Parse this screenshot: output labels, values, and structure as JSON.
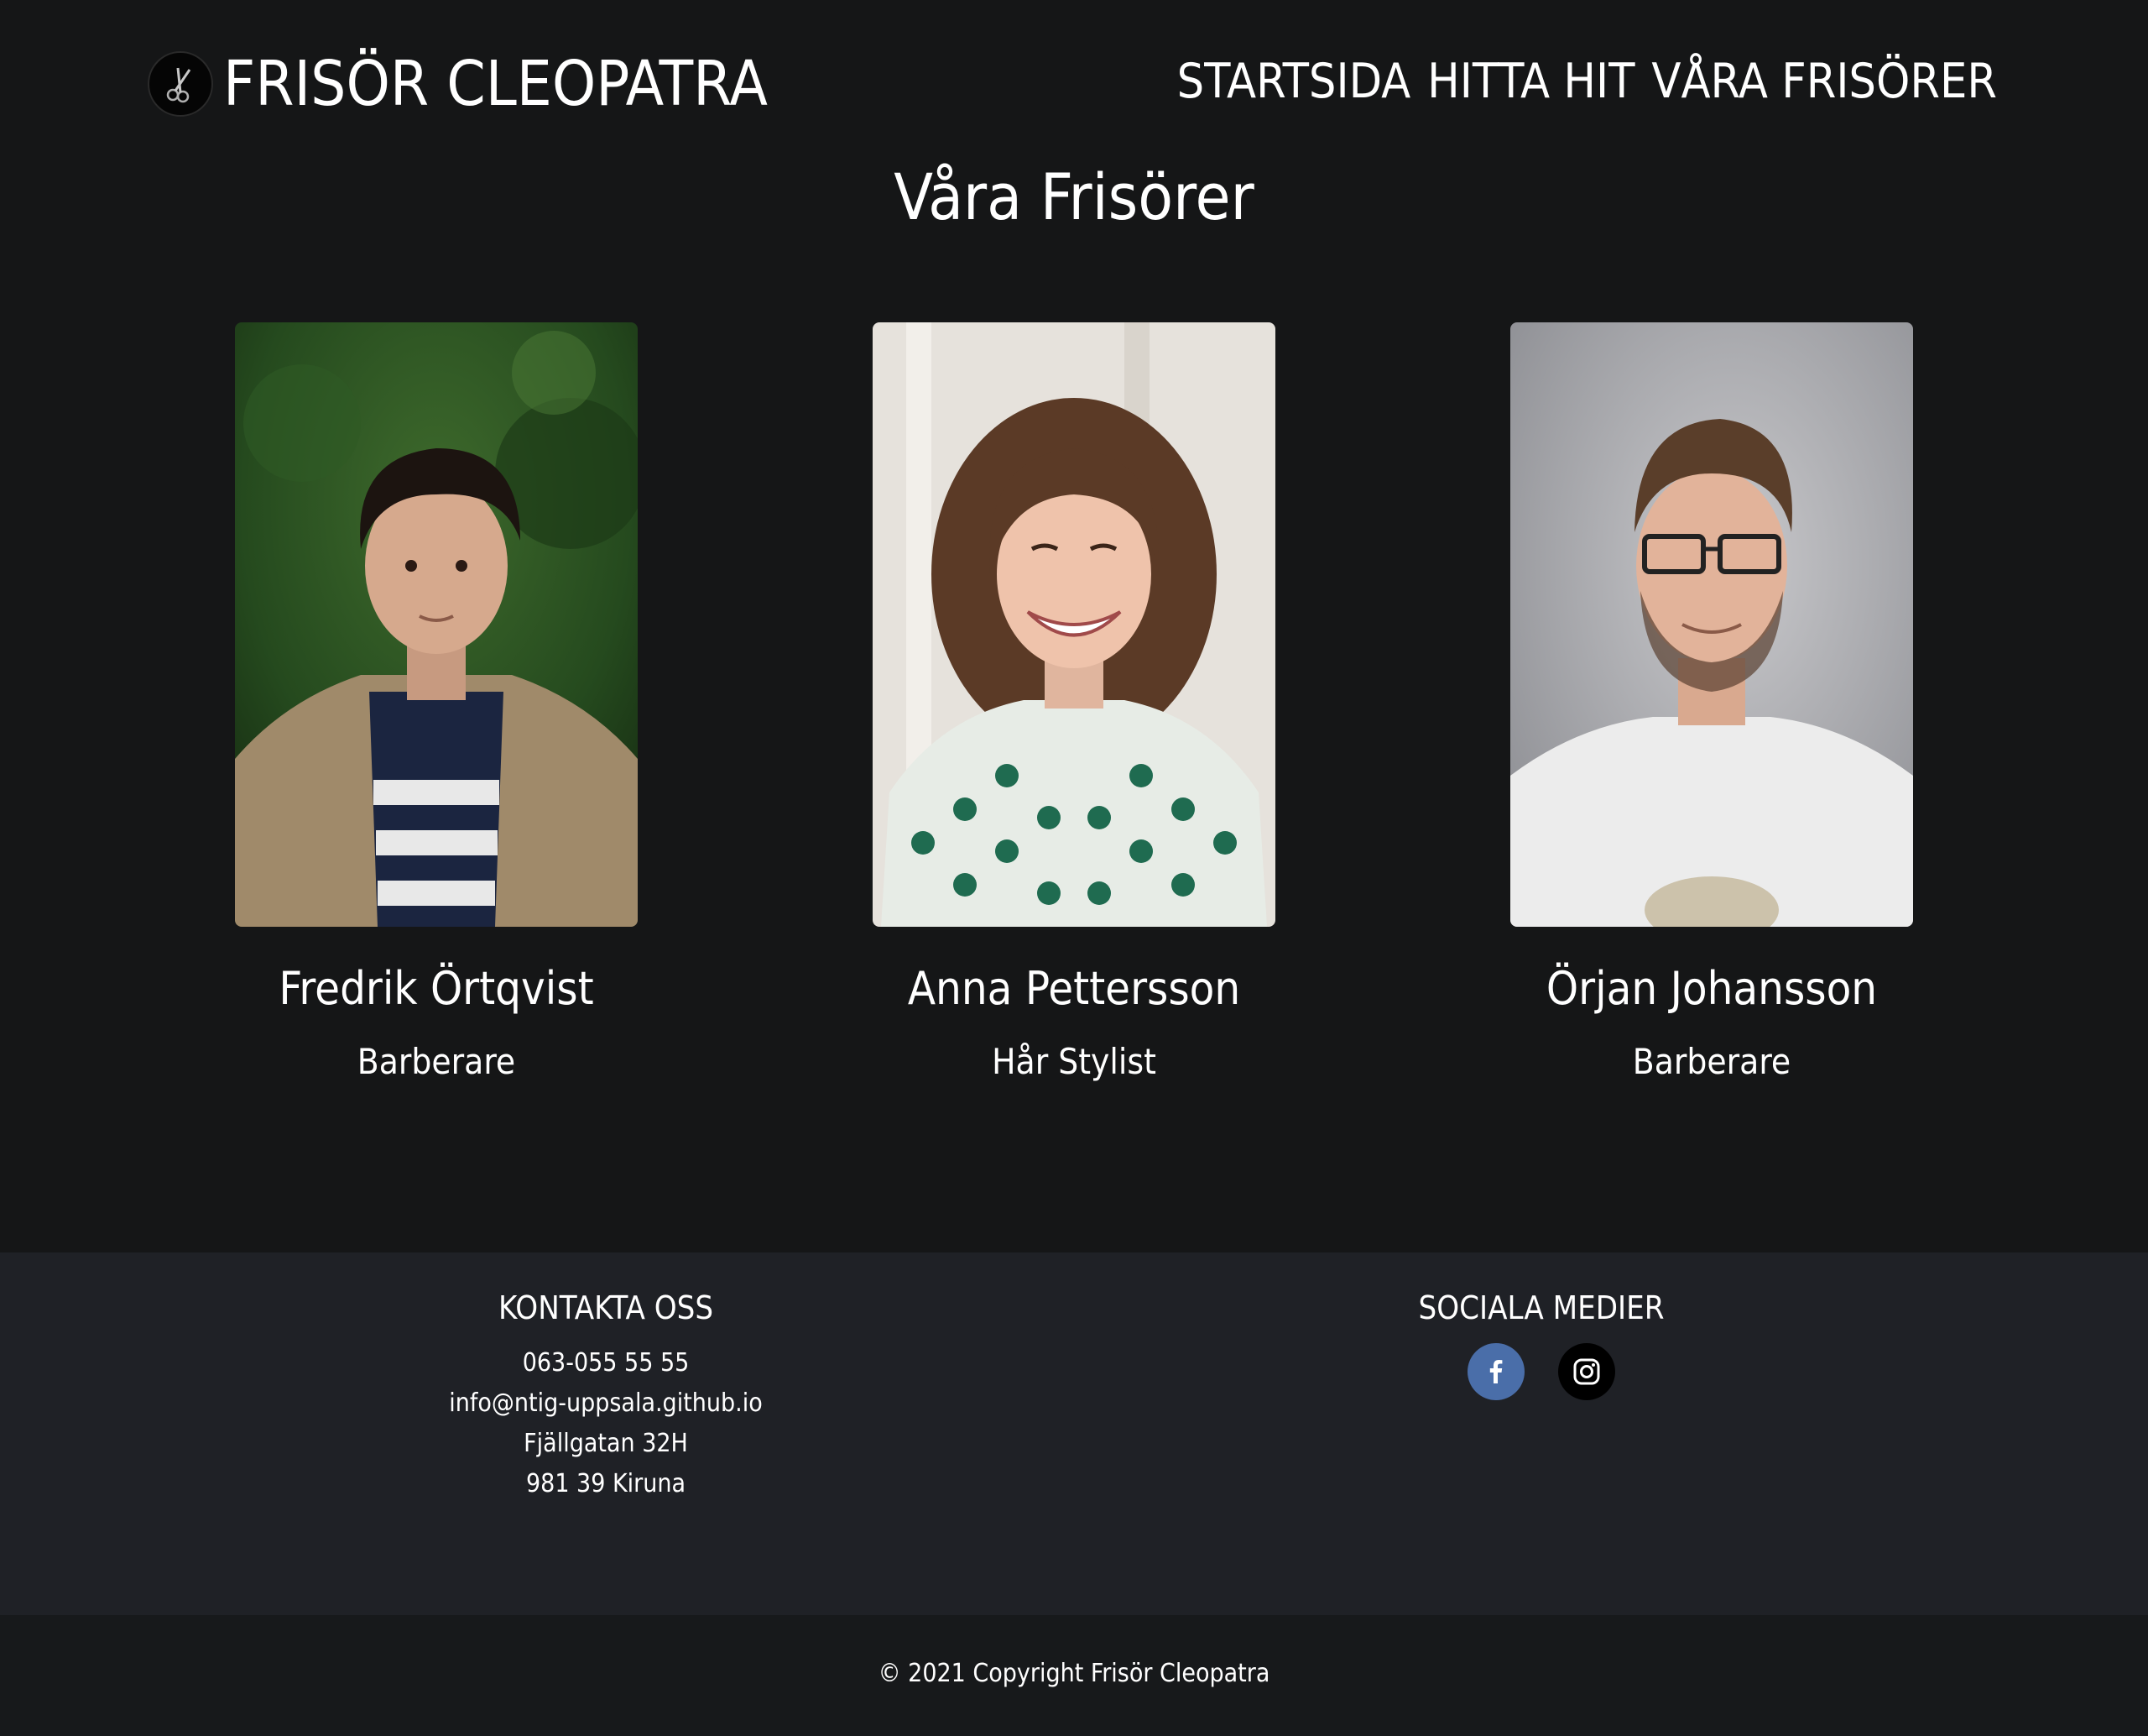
{
  "header": {
    "brand": "FRISÖR CLEOPATRA",
    "nav": [
      "STARTSIDA",
      "HITTA HIT",
      "VÅRA FRISÖRER"
    ]
  },
  "page_title": "Våra Frisörer",
  "stylists": [
    {
      "name": "Fredrik Örtqvist",
      "role": "Barberare"
    },
    {
      "name": "Anna Pettersson",
      "role": "Hår Stylist"
    },
    {
      "name": "Örjan Johansson",
      "role": "Barberare"
    }
  ],
  "footer": {
    "contact": {
      "heading": "KONTAKTA OSS",
      "phone": "063-055 55 55",
      "email": "info@ntig-uppsala.github.io",
      "street": "Fjällgatan 32H",
      "city": "981 39 Kiruna"
    },
    "social": {
      "heading": "SOCIALA MEDIER",
      "icons": [
        "facebook-icon",
        "instagram-icon"
      ]
    },
    "copyright": "© 2021 Copyright Frisör Cleopatra"
  },
  "colors": {
    "background": "#151617",
    "footer": "#1f2126",
    "footer_bottom": "#17191b",
    "facebook": "#4a6ea9"
  }
}
